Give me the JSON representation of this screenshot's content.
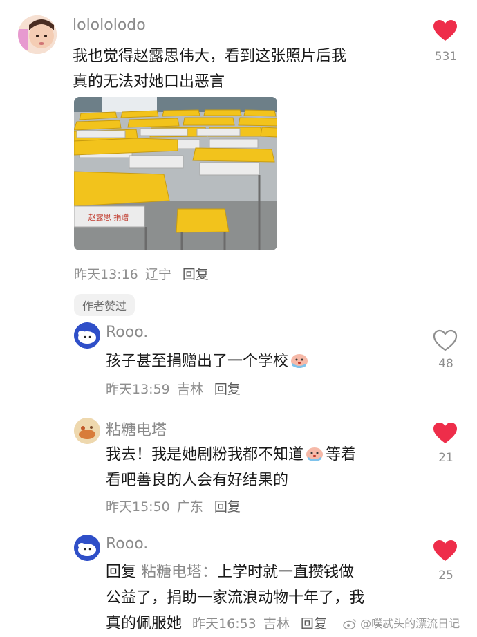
{
  "comment1": {
    "username": "lolololodo",
    "line1": "我也觉得赵露思伟大，看到这张照片后我",
    "line2": "真的无法对她口出恶言",
    "time": "昨天13:16",
    "location": "辽宁",
    "reply_label": "回复",
    "likes": "531",
    "liked": true,
    "author_badge": "作者赞过"
  },
  "reply1": {
    "username": "Rooo.",
    "text": "孩子甚至捐赠出了一个学校",
    "emoji": "crying-face-emoji",
    "time": "昨天13:59",
    "location": "吉林",
    "reply_label": "回复",
    "likes": "48",
    "liked": false
  },
  "reply2": {
    "username": "粘糖电塔",
    "line1_a": "我去！我是她剧粉我都不知道",
    "line1_b": "等着",
    "emoji": "crying-face-emoji",
    "line2": "看吧善良的人会有好结果的",
    "time": "昨天15:50",
    "location": "广东",
    "reply_label": "回复",
    "likes": "21",
    "liked": true
  },
  "reply3": {
    "username": "Rooo.",
    "reply_prefix": "回复",
    "reply_to": "粘糖电塔：",
    "line1": "上学时就一直攒钱做",
    "line2": "公益了，捐助一家流浪动物十年了，我",
    "line3": "真的佩服她",
    "time": "昨天16:53",
    "location": "吉林",
    "reply_label": "回复",
    "likes": "25",
    "liked": true
  },
  "photo": {
    "desk_label": "赵露思 捐赠"
  },
  "watermark": "@噗忒头的漂流日记",
  "colors": {
    "heart_red": "#ee2d4a",
    "desk_yellow": "#f2c31c",
    "muted_text": "#8e8e8e"
  }
}
